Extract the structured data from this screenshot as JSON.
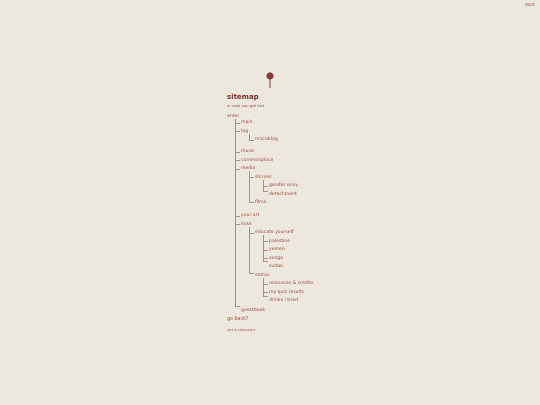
{
  "top_link": "dark",
  "title": "sitemap",
  "subtitle": "in case you got lost",
  "tree": {
    "root": "enter",
    "main": "main",
    "log": "log",
    "microblog": "microblog",
    "music": "music",
    "commonplace": "commonplace",
    "media": "media",
    "shrines": "shrines",
    "gender_envy": "gender envy",
    "detachment": "detachment",
    "films": "films",
    "your_art": "your art",
    "links": "links",
    "educate_yourself": "educate yourself",
    "palestine": "palestine",
    "yemen": "yemen",
    "congo": "congo",
    "sudan": "sudan",
    "extras": "extras",
    "resources_credits": "resources & credits",
    "my_quiz_results": "my quiz results",
    "drinks_i_tried": "drinks i tried",
    "guestbook": "guestbook"
  },
  "go_back": "go back?",
  "credit": "jack & nekovague",
  "colors": {
    "background": "#ede8dd",
    "accent": "#8a3a36",
    "line": "#b58c86"
  },
  "icons": {
    "pin": "map-pin-icon"
  }
}
